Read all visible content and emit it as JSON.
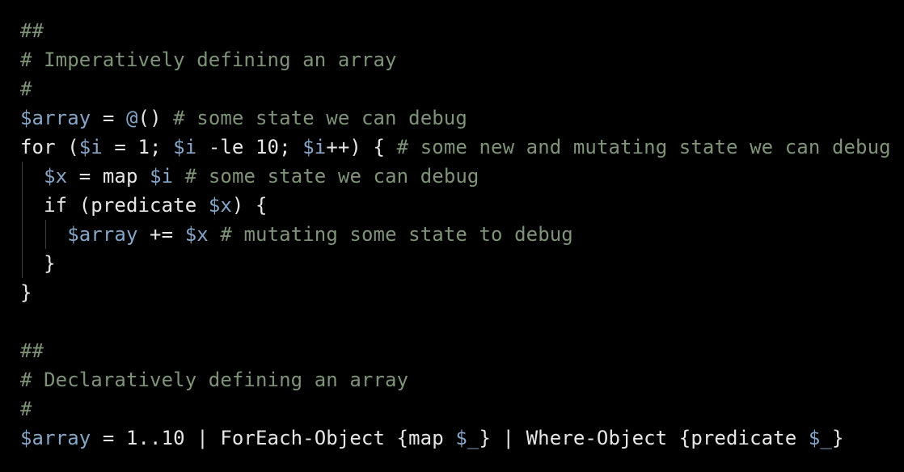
{
  "code": {
    "line_1": {
      "comment": "##"
    },
    "line_2": {
      "comment": "# Imperatively defining an array"
    },
    "line_3": {
      "comment": "#"
    },
    "line_4": {
      "var": "$array",
      "op": " = ",
      "at": "@",
      "rest": "() ",
      "comment": "# some state we can debug"
    },
    "line_5": {
      "kw": "for (",
      "var1": "$i",
      "t1": " = 1; ",
      "var2": "$i",
      "t2": " -le 10; ",
      "var3": "$i",
      "t3": "++) { ",
      "comment": "# some new and mutating state we can debug"
    },
    "line_6": {
      "indent": "  ",
      "var1": "$x",
      "t1": " = map ",
      "var2": "$i",
      "t2": " ",
      "comment": "# some state we can debug"
    },
    "line_7": {
      "indent": "  ",
      "t1": "if (predicate ",
      "var1": "$x",
      "t2": ") {"
    },
    "line_8": {
      "indent": "    ",
      "var1": "$array",
      "t1": " += ",
      "var2": "$x",
      "t2": " ",
      "comment": "# mutating some state to debug"
    },
    "line_9": {
      "indent": "  ",
      "t1": "}"
    },
    "line_10": {
      "t1": "}"
    },
    "line_12": {
      "comment": "##"
    },
    "line_13": {
      "comment": "# Declaratively defining an array"
    },
    "line_14": {
      "comment": "#"
    },
    "line_15": {
      "var1": "$array",
      "t1": " = 1..10 | ForEach-Object {map ",
      "var2": "$_",
      "t2": "} | Where-Object {predicate ",
      "var3": "$_",
      "t3": "}"
    }
  },
  "colors": {
    "background": "#000000",
    "text": "#e6e6e6",
    "comment": "#7e9378",
    "variable": "#86a6c8",
    "indent_guide": "#3d3d3d"
  }
}
